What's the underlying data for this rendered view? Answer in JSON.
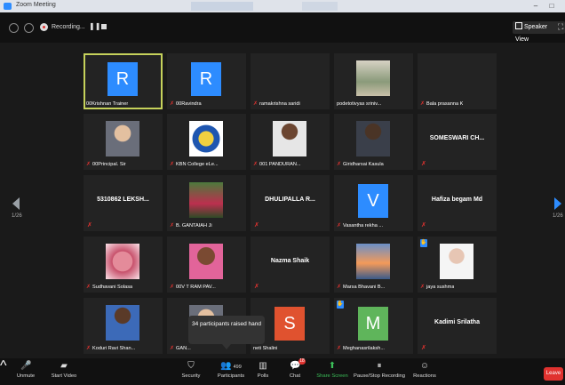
{
  "window": {
    "title": "Zoom Meeting"
  },
  "topbar": {
    "recording_label": "Recording...",
    "pause_glyph": "❚❚",
    "speaker_view": "Speaker View"
  },
  "nav": {
    "page_left": "1/26",
    "page_right": "1/26"
  },
  "tiles": [
    {
      "name": "00Krishnan Trainer",
      "avatar": "R",
      "color": "#2d8cff",
      "mic": false,
      "active": true
    },
    {
      "name": "00Ravindra",
      "avatar": "R",
      "color": "#2d8cff",
      "mic": true
    },
    {
      "name": "ramakrishna saridi",
      "mic": true
    },
    {
      "name": "podetotivyas sriniv...",
      "photo": "plant",
      "mic": false
    },
    {
      "name": "Bala prasanna K",
      "mic": true
    },
    {
      "name": "00Principal. Sir",
      "photo": "person-light",
      "mic": true
    },
    {
      "name": "KBN College eLe...",
      "photo": "logo",
      "mic": true
    },
    {
      "name": "001 PANDURAN...",
      "photo": "person-shirt",
      "mic": true
    },
    {
      "name": "Giridharsai Kasula",
      "photo": "person-dark",
      "mic": true
    },
    {
      "bigname": "SOMESWARI CH...",
      "mic": true
    },
    {
      "bigname": "5310862 LEKSH...",
      "mic": true
    },
    {
      "name": "B. GANTAIAH Ji",
      "photo": "garden",
      "mic": true
    },
    {
      "bigname": "DHULIPALLA R...",
      "mic": true
    },
    {
      "name": "Vasantha rekha ...",
      "avatar": "V",
      "color": "#2d8cff",
      "mic": true
    },
    {
      "bigname": "Hafiza begam Md",
      "mic": true
    },
    {
      "name": "Sudhavani Solasa",
      "photo": "flowers",
      "mic": true
    },
    {
      "name": "00V T RAM PAV...",
      "photo": "man-pink",
      "mic": true
    },
    {
      "bigname": "Nazma Shaik",
      "mic": true
    },
    {
      "name": "Marsa Bhavani B...",
      "photo": "sunset",
      "mic": true
    },
    {
      "name": "jaya sushma",
      "photo": "woman",
      "mic": true,
      "raised": true
    },
    {
      "name": "Koduri Ravi Shan...",
      "photo": "man-blue",
      "mic": true
    },
    {
      "name": "GAN...",
      "photo": "person-light",
      "mic": true
    },
    {
      "name": "neti Shalini",
      "avatar": "S",
      "color": "#e0522f",
      "mic": false
    },
    {
      "name": "Meghanasrilaksh...",
      "avatar": "M",
      "color": "#5fb55b",
      "mic": true,
      "raised": true
    },
    {
      "bigname": "Kadimi Srilatha",
      "mic": true
    }
  ],
  "tooltip": {
    "text": "34 participants raised hand"
  },
  "toolbar": {
    "unmute": "Unmute",
    "start_video": "Start Video",
    "security": "Security",
    "participants": "Participants",
    "participants_count": "499",
    "polls": "Polls",
    "chat": "Chat",
    "chat_badge": "18",
    "share_screen": "Share Screen",
    "pause_stop": "Pause/Stop Recording",
    "reactions": "Reactions",
    "leave": "Leave"
  }
}
